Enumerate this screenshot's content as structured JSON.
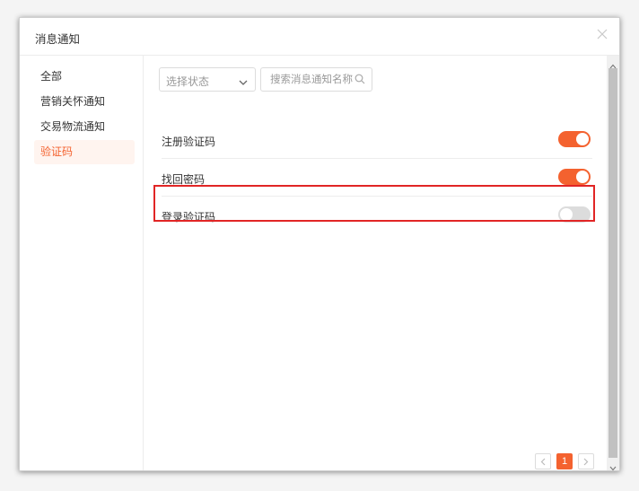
{
  "dialog": {
    "title": "消息通知"
  },
  "sidebar": {
    "items": [
      {
        "label": "全部",
        "active": false
      },
      {
        "label": "营销关怀通知",
        "active": false
      },
      {
        "label": "交易物流通知",
        "active": false
      },
      {
        "label": "验证码",
        "active": true
      }
    ]
  },
  "filters": {
    "status_select_value": "选择状态",
    "search_placeholder": "搜索消息通知名称"
  },
  "notifications": [
    {
      "label": "注册验证码",
      "enabled": true
    },
    {
      "label": "找回密码",
      "enabled": true
    },
    {
      "label": "登录验证码",
      "enabled": false
    }
  ],
  "pagination": {
    "current_page": "1"
  },
  "colors": {
    "accent": "#f4622f",
    "toggle_off": "#dcdcdc",
    "highlight": "#e12525"
  },
  "icons": [
    "close-icon",
    "chevron-down-icon",
    "search-icon",
    "chevron-left-icon",
    "chevron-right-icon"
  ]
}
